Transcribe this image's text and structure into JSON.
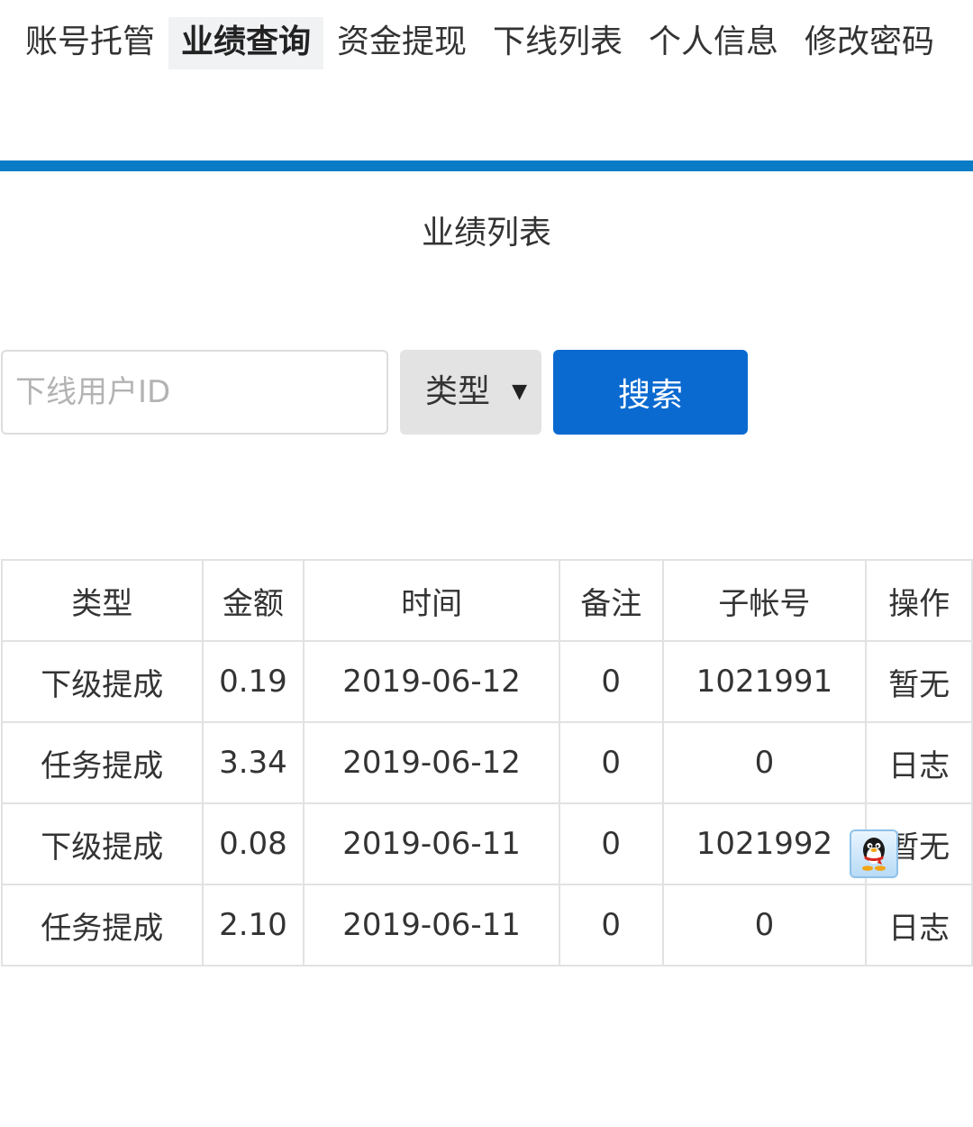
{
  "nav": {
    "tabs": [
      {
        "label": "账号托管",
        "active": false
      },
      {
        "label": "业绩查询",
        "active": true
      },
      {
        "label": "资金提现",
        "active": false
      },
      {
        "label": "下线列表",
        "active": false
      },
      {
        "label": "个人信息",
        "active": false
      },
      {
        "label": "修改密码",
        "active": false
      }
    ]
  },
  "page": {
    "title": "业绩列表"
  },
  "search": {
    "input_value": "",
    "input_placeholder": "下线用户ID",
    "type_select_value": "类型",
    "button_label": "搜索"
  },
  "table": {
    "headers": [
      "类型",
      "金额",
      "时间",
      "备注",
      "子帐号",
      "操作"
    ],
    "rows": [
      [
        "下级提成",
        "0.19",
        "2019-06-12",
        "0",
        "1021991",
        "暂无"
      ],
      [
        "任务提成",
        "3.34",
        "2019-06-12",
        "0",
        "0",
        "日志"
      ],
      [
        "下级提成",
        "0.08",
        "2019-06-11",
        "0",
        "1021992",
        "暂无"
      ],
      [
        "任务提成",
        "2.10",
        "2019-06-11",
        "0",
        "0",
        "日志"
      ]
    ]
  },
  "floating": {
    "icon": "qq-penguin-icon"
  },
  "colors": {
    "accent": "#0a7cc6",
    "button": "#0a6ad0",
    "select_bg": "#e3e3e3",
    "active_tab_bg": "#f0f2f4"
  }
}
